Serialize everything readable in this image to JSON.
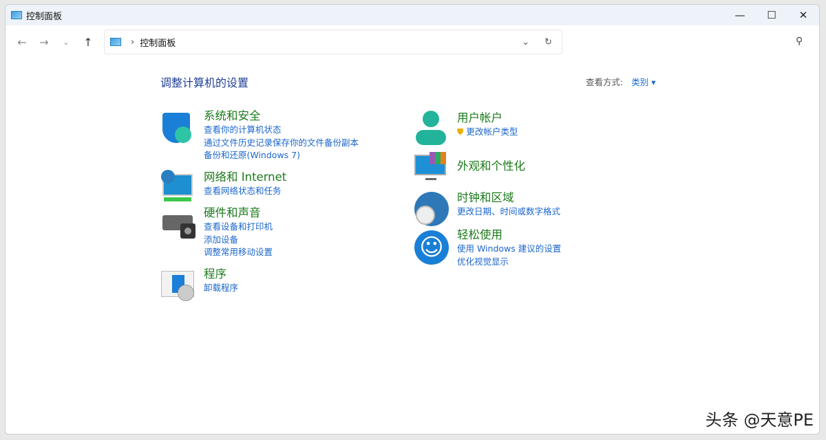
{
  "window": {
    "title": "控制面板"
  },
  "address": {
    "path": "控制面板"
  },
  "search": {
    "placeholder": ""
  },
  "main": {
    "heading": "调整计算机的设置",
    "view_label": "查看方式:",
    "view_value": "类别"
  },
  "categories": [
    {
      "title": "系统和安全",
      "links": [
        "查看你的计算机状态",
        "通过文件历史记录保存你的文件备份副本",
        "备份和还原(Windows 7)"
      ]
    },
    {
      "title": "网络和 Internet",
      "links": [
        "查看网络状态和任务"
      ]
    },
    {
      "title": "硬件和声音",
      "links": [
        "查看设备和打印机",
        "添加设备",
        "调整常用移动设置"
      ]
    },
    {
      "title": "程序",
      "links": [
        "卸载程序"
      ]
    },
    {
      "title": "用户帐户",
      "links": [
        "更改帐户类型"
      ]
    },
    {
      "title": "外观和个性化",
      "links": []
    },
    {
      "title": "时钟和区域",
      "links": [
        "更改日期、时间或数字格式"
      ]
    },
    {
      "title": "轻松使用",
      "links": [
        "使用 Windows 建议的设置",
        "优化视觉显示"
      ]
    }
  ],
  "watermark": "头条 @天意PE"
}
